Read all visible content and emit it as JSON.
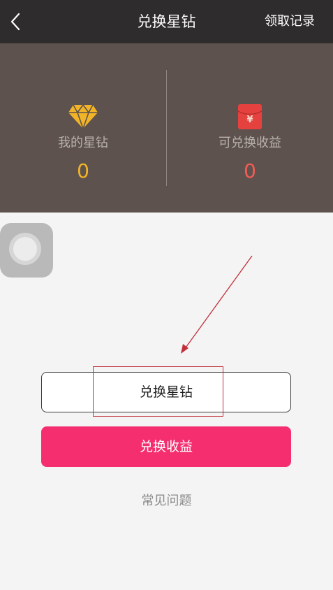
{
  "header": {
    "title": "兑换星钻",
    "records_label": "领取记录",
    "background": "#2e2c2c"
  },
  "stats": {
    "background": "#5d524e",
    "my_diamonds": {
      "icon": "diamond-icon",
      "label": "我的星钻",
      "value": "0",
      "value_color": "#f2b427"
    },
    "exchangeable_income": {
      "icon": "red-envelope-icon",
      "label": "可兑换收益",
      "value": "0",
      "value_color": "#f25d55"
    }
  },
  "actions": {
    "exchange_diamonds_label": "兑换星钻",
    "exchange_income_label": "兑换收益",
    "exchange_income_color": "#f42e6f",
    "faq_label": "常见问题"
  },
  "annotation": {
    "color": "#c0303a"
  }
}
